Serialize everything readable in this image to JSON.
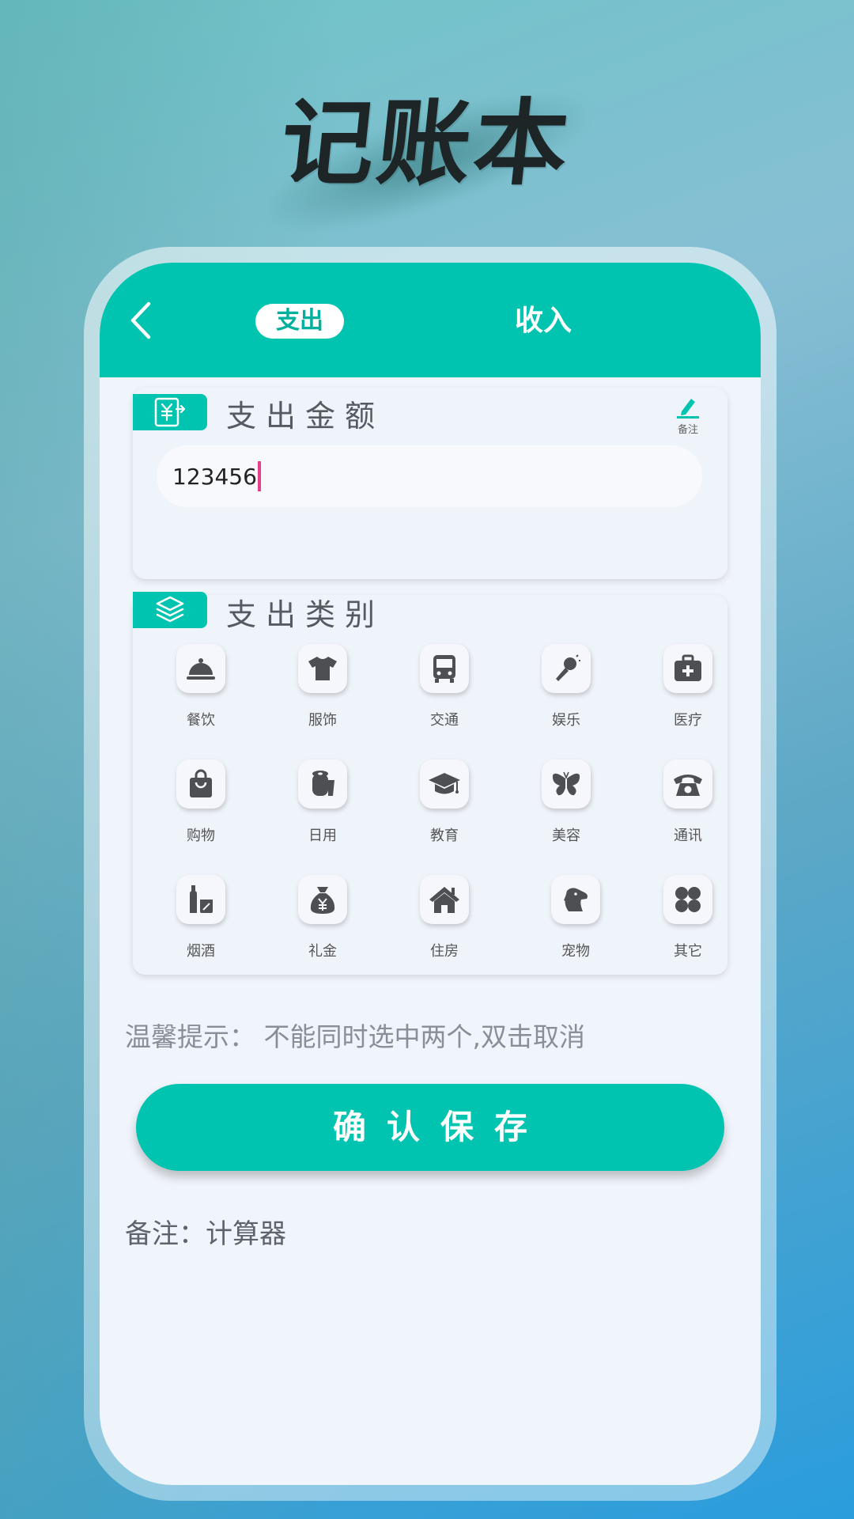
{
  "app_title": "记账本",
  "header": {
    "back_icon": "chevron-left-icon",
    "tab_expense": "支出",
    "tab_income": "收入"
  },
  "amount_section": {
    "title": "支出金额",
    "badge_icon": "yuan-transfer-icon",
    "note_icon": "pencil-icon",
    "note_label": "备注",
    "input_value": "123456"
  },
  "category_section": {
    "title": "支出类别",
    "badge_icon": "layers-icon",
    "items": [
      {
        "label": "餐饮",
        "icon": "food-cloche-icon"
      },
      {
        "label": "服饰",
        "icon": "tshirt-icon"
      },
      {
        "label": "交通",
        "icon": "bus-icon"
      },
      {
        "label": "娱乐",
        "icon": "microphone-icon"
      },
      {
        "label": "医疗",
        "icon": "medical-kit-icon"
      },
      {
        "label": "购物",
        "icon": "shopping-bag-icon"
      },
      {
        "label": "日用",
        "icon": "toilet-paper-icon"
      },
      {
        "label": "教育",
        "icon": "graduation-cap-icon"
      },
      {
        "label": "美容",
        "icon": "butterfly-icon"
      },
      {
        "label": "通讯",
        "icon": "telephone-icon"
      },
      {
        "label": "烟酒",
        "icon": "bottle-cigarette-icon"
      },
      {
        "label": "礼金",
        "icon": "money-bag-icon"
      },
      {
        "label": "住房",
        "icon": "house-icon"
      },
      {
        "label": "宠物",
        "icon": "dog-icon"
      },
      {
        "label": "其它",
        "icon": "grid-clover-icon"
      }
    ]
  },
  "tip": "温馨提示： 不能同时选中两个,双击取消",
  "save_label": "确认保存",
  "remark": "备注：计算器",
  "colors": {
    "accent": "#00c4b0",
    "icon_gray": "#4d4f52",
    "caret": "#e83e8c"
  }
}
